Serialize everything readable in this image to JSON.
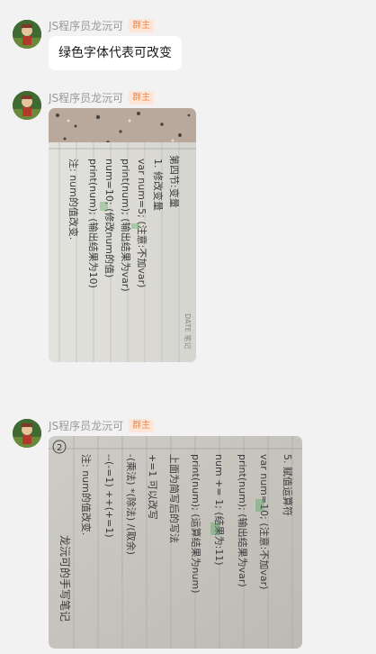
{
  "messages": [
    {
      "sender": "JS程序员龙沅可",
      "role": "群主",
      "type": "text",
      "text": "绿色字体代表可改变"
    },
    {
      "sender": "JS程序员龙沅可",
      "role": "群主",
      "type": "image",
      "handwriting": {
        "title": "第四节:变量",
        "lines": [
          "1. 修改变量",
          "var num=5; (注意:不加var)",
          "print(num); (输出结果为var)",
          "num=10; (修改num的值)",
          "print(num); (输出结果为10)",
          "注: num的值改变."
        ],
        "corner": "DATE 笔记"
      }
    },
    {
      "sender": "JS程序员龙沅可",
      "role": "群主",
      "type": "image",
      "handwriting": {
        "lines": [
          "5. 赋值运算符",
          "var num=10; (注意:不加var)",
          "print(num); (输出结果为var)",
          "num += 1; (结果为:11)",
          "print(num); (运算结果为num)",
          "上面为简写后的写法",
          "+=1  可以改写",
          "-(乘法) *(除法) /(取余)",
          "--(-=1)  ++(+=1)",
          "注: num的值改变."
        ],
        "circle_num": "2",
        "signature": "龙沅可的手写笔记"
      }
    }
  ]
}
